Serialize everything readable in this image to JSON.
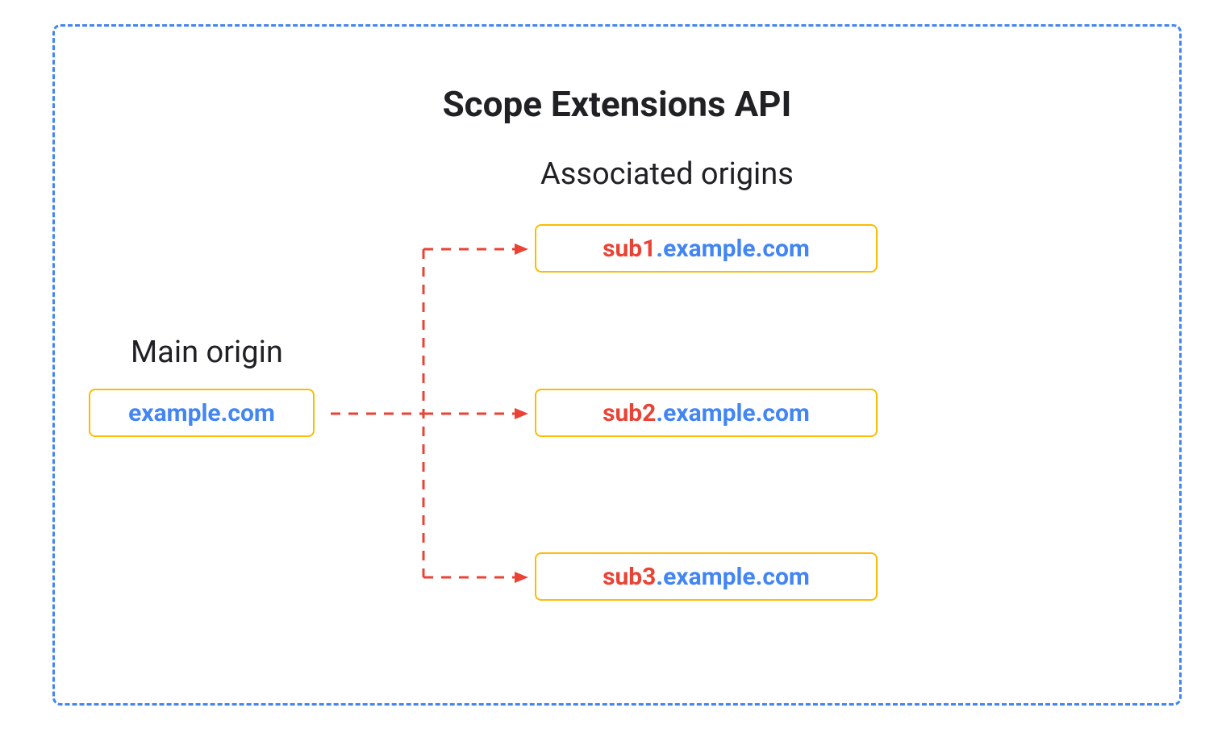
{
  "title": "Scope Extensions API",
  "mainOriginLabel": "Main origin",
  "associatedOriginsLabel": "Associated origins",
  "mainOrigin": {
    "domain": "example.com"
  },
  "associatedOrigins": [
    {
      "sub": "sub1",
      "domain": ".example.com"
    },
    {
      "sub": "sub2",
      "domain": ".example.com"
    },
    {
      "sub": "sub3",
      "domain": ".example.com"
    }
  ]
}
